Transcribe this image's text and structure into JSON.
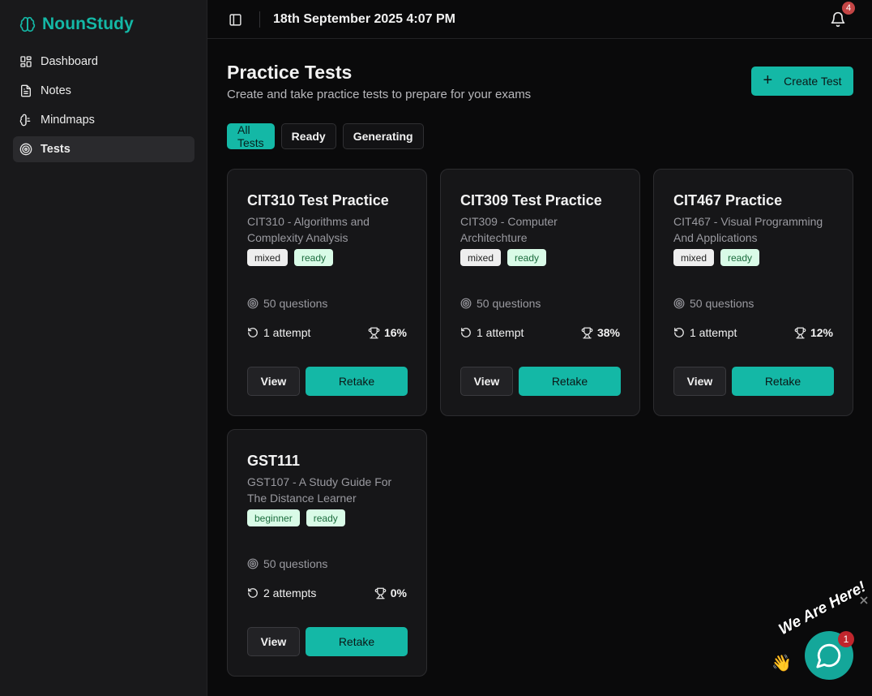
{
  "app": {
    "name": "NounStudy"
  },
  "sidebar": {
    "items": [
      {
        "label": "Dashboard",
        "icon": "dashboard-icon",
        "active": false
      },
      {
        "label": "Notes",
        "icon": "notes-icon",
        "active": false
      },
      {
        "label": "Mindmaps",
        "icon": "brain-icon",
        "active": false
      },
      {
        "label": "Tests",
        "icon": "target-icon",
        "active": true
      }
    ]
  },
  "topbar": {
    "datetime": "18th September 2025 4:07 PM",
    "notification_count": "4"
  },
  "page": {
    "title": "Practice Tests",
    "subtitle": "Create and take practice tests to prepare for your exams",
    "create_label": "Create Test"
  },
  "filters": [
    "All Tests",
    "Ready",
    "Generating"
  ],
  "tests": [
    {
      "title": "CIT310 Test Practice",
      "course": "CIT310 - Algorithms and Complexity Analysis",
      "tags": [
        "mixed",
        "ready"
      ],
      "questions": "50 questions",
      "attempts": "1 attempt",
      "score": "16%",
      "view_label": "View",
      "retake_label": "Retake"
    },
    {
      "title": "CIT309 Test Practice",
      "course": "CIT309 - Computer Architechture",
      "tags": [
        "mixed",
        "ready"
      ],
      "questions": "50 questions",
      "attempts": "1 attempt",
      "score": "38%",
      "view_label": "View",
      "retake_label": "Retake"
    },
    {
      "title": "CIT467 Practice",
      "course": "CIT467 - Visual Programming And Applications",
      "tags": [
        "mixed",
        "ready"
      ],
      "questions": "50 questions",
      "attempts": "1 attempt",
      "score": "12%",
      "view_label": "View",
      "retake_label": "Retake"
    },
    {
      "title": "GST111",
      "course": "GST107 - A Study Guide For The Distance Learner",
      "tags": [
        "beginner",
        "ready"
      ],
      "questions": "50 questions",
      "attempts": "2 attempts",
      "score": "0%",
      "view_label": "View",
      "retake_label": "Retake"
    }
  ],
  "chat": {
    "text": "We Are Here!",
    "badge": "1"
  },
  "colors": {
    "accent": "#14b8a6",
    "background": "#0a0a0b",
    "sidebar": "#19191b",
    "card": "#161618"
  }
}
